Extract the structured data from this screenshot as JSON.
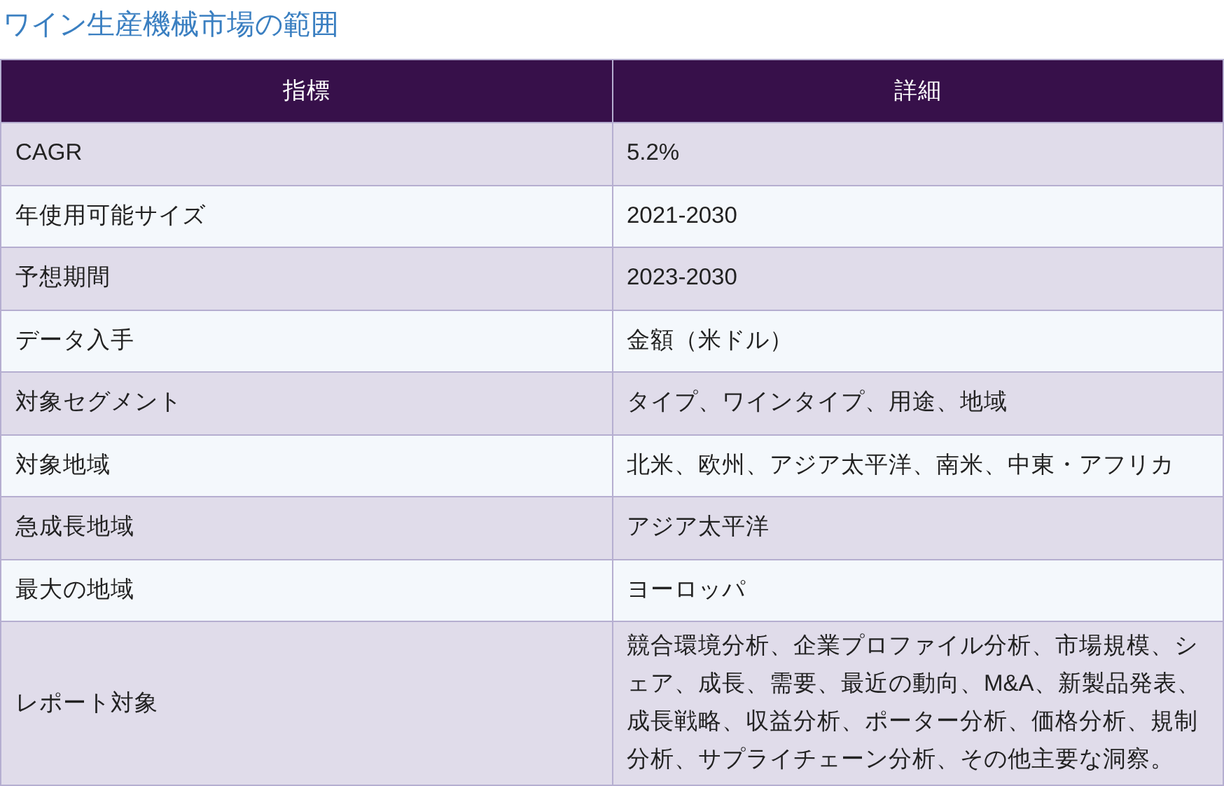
{
  "title": "ワイン生産機械市場の範囲",
  "table": {
    "columns": [
      "指標",
      "詳細"
    ],
    "rows": [
      [
        "CAGR",
        "5.2%"
      ],
      [
        "年使用可能サイズ",
        "2021-2030"
      ],
      [
        "予想期間",
        "2023-2030"
      ],
      [
        "データ入手",
        "金額（米ドル）"
      ],
      [
        "対象セグメント",
        "タイプ、ワインタイプ、用途、地域"
      ],
      [
        "対象地域",
        "北米、欧州、アジア太平洋、南米、中東・アフリカ"
      ],
      [
        "急成長地域",
        "アジア太平洋"
      ],
      [
        "最大の地域",
        "ヨーロッパ"
      ],
      [
        "レポート対象",
        "競合環境分析、企業プロファイル分析、市場規模、シェア、成長、需要、最近の動向、M&A、新製品発表、成長戦略、収益分析、ポーター分析、価格分析、規制分析、サプライチェーン分析、その他主要な洞察。"
      ]
    ]
  }
}
